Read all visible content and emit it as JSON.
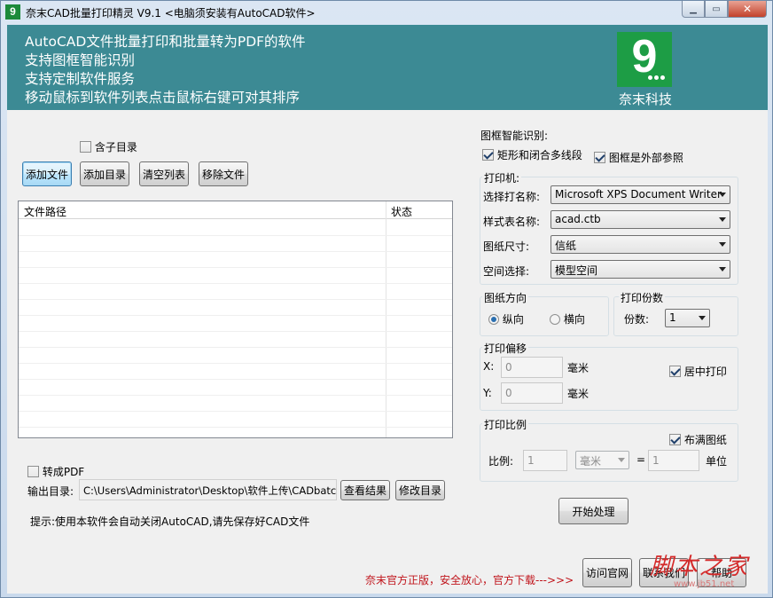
{
  "window": {
    "title": "奈末CAD批量打印精灵    V9.1   <电脑须安装有AutoCAD软件>",
    "app_icon_glyph": "9",
    "minimize_glyph": "▁",
    "maximize_glyph": "▭",
    "close_glyph": "✕"
  },
  "banner": {
    "lines": [
      "AutoCAD文件批量打印和批量转为PDF的软件",
      "支持图框智能识别",
      "支持定制软件服务",
      "移动鼠标到软件列表点击鼠标右键可对其排序"
    ],
    "logo_glyph": "9",
    "logo_caption": "奈末科技",
    "background": "#3c8a94",
    "logo_color": "#1d9d45"
  },
  "file_panel": {
    "include_subdir_label": "含子目录",
    "include_subdir_checked": false,
    "buttons": {
      "add_file": "添加文件",
      "add_dir": "添加目录",
      "clear_list": "清空列表",
      "remove_file": "移除文件"
    },
    "columns": {
      "path": "文件路径",
      "status": "状态"
    },
    "convert_pdf_label": "转成PDF",
    "convert_pdf_checked": false,
    "output_dir_label": "输出目录:",
    "output_dir_value": "C:\\Users\\Administrator\\Desktop\\软件上传\\CADbatch",
    "view_result": "查看结果",
    "change_dir": "修改目录",
    "tip": "提示:使用本软件会自动关闭AutoCAD,请先保存好CAD文件"
  },
  "frame_detect": {
    "title": "图框智能识别:",
    "rect_polyline_label": "矩形和闭合多线段",
    "rect_polyline_checked": true,
    "external_ref_label": "图框是外部参照",
    "external_ref_checked": true
  },
  "printer": {
    "group_label": "打印机:",
    "printer_name_label": "选择打名称:",
    "printer_name_value": "Microsoft XPS Document Writer",
    "style_label": "样式表名称:",
    "style_value": "acad.ctb",
    "paper_label": "图纸尺寸:",
    "paper_value": "信纸",
    "space_label": "空间选择:",
    "space_value": "模型空间"
  },
  "orientation": {
    "group_label": "图纸方向",
    "portrait": "纵向",
    "landscape": "横向",
    "selected": "纵向"
  },
  "copies": {
    "group_label": "打印份数",
    "label": "份数:",
    "value": "1"
  },
  "offset": {
    "group_label": "打印偏移",
    "x_label": "X:",
    "x_value": "0",
    "y_label": "Y:",
    "y_value": "0",
    "unit": "毫米",
    "center_label": "居中打印",
    "center_checked": true
  },
  "scale": {
    "group_label": "打印比例",
    "fill_label": "布满图纸",
    "fill_checked": true,
    "ratio_label": "比例:",
    "ratio_value": "1",
    "unit_value": "毫米",
    "equals": "=",
    "unit_count": "1",
    "unit_label": "单位"
  },
  "actions": {
    "start": "开始处理",
    "visit_site": "访问官网",
    "contact": "联系我们",
    "help": "帮助",
    "promo": "奈末官方正版，安全放心，官方下载--->>>"
  },
  "watermark": {
    "main": "脚本之家",
    "site": "www.jb51.net"
  }
}
